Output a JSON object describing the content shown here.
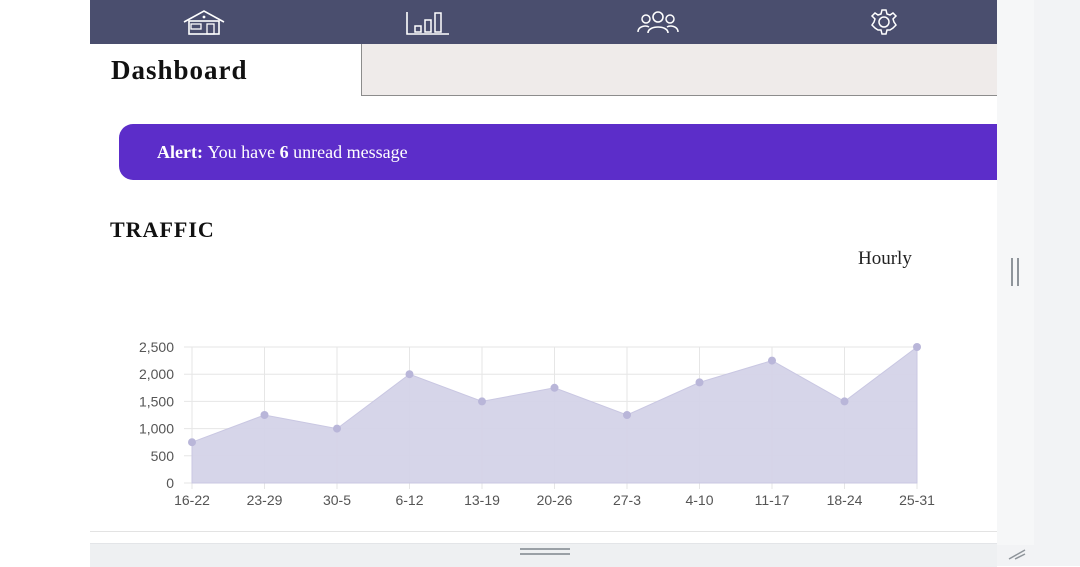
{
  "nav": {
    "items": [
      {
        "icon": "home-icon"
      },
      {
        "icon": "bar-chart-icon"
      },
      {
        "icon": "users-icon"
      },
      {
        "icon": "gear-icon"
      }
    ]
  },
  "tabs": {
    "active_label": "Dashboard"
  },
  "alert": {
    "prefix": "Alert:",
    "text_before": "You have",
    "count": "6",
    "text_after": "unread message"
  },
  "traffic": {
    "title": "TRAFFIC",
    "period": "Hourly"
  },
  "colors": {
    "navbar": "#4a4e6e",
    "alert": "#5c2dc9",
    "chart_fill": "#d4d3e8",
    "chart_point": "#b9b6d9"
  },
  "chart_data": {
    "type": "area",
    "categories": [
      "16-22",
      "23-29",
      "30-5",
      "6-12",
      "13-19",
      "20-26",
      "27-3",
      "4-10",
      "11-17",
      "18-24",
      "25-31"
    ],
    "series": [
      {
        "values": [
          750,
          1250,
          1000,
          2000,
          1500,
          1750,
          1250,
          1850,
          2250,
          1500,
          2500
        ]
      }
    ],
    "ylim": [
      0,
      2500
    ],
    "yticks": [
      "0",
      "500",
      "1,000",
      "1,500",
      "2,000",
      "2,500"
    ],
    "grid": true,
    "title": "",
    "xlabel": "",
    "ylabel": ""
  }
}
